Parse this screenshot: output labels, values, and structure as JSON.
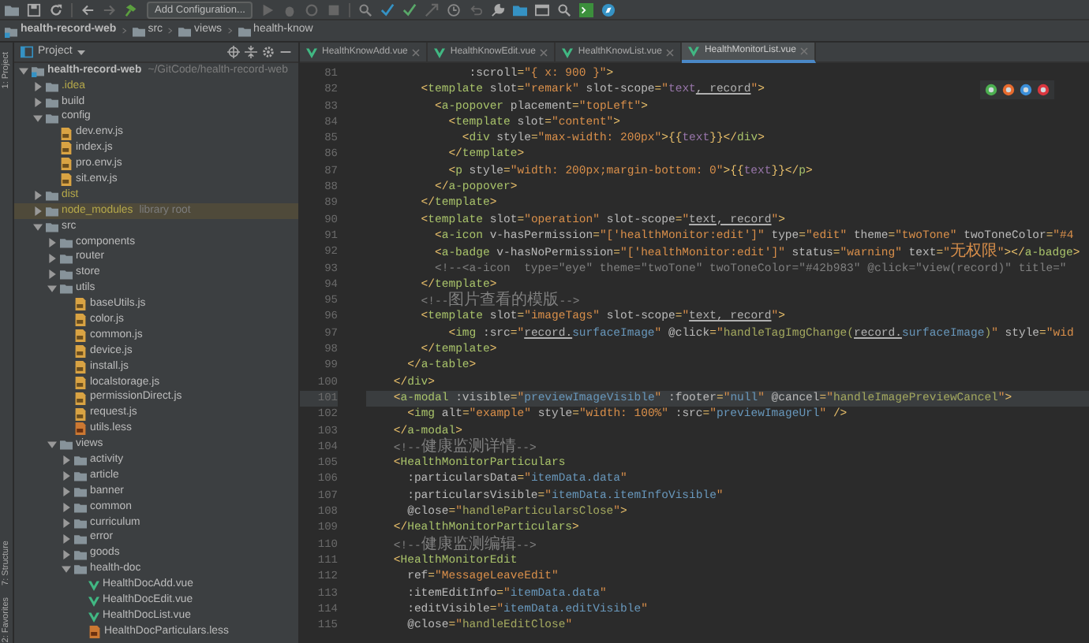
{
  "toolbar": {
    "run_config": "Add Configuration..."
  },
  "breadcrumb": [
    "health-record-web",
    "src",
    "views",
    "health-know"
  ],
  "side_stripe": [
    "1: Project",
    "7: Structure",
    "2: Favorites"
  ],
  "project_panel": {
    "title": "Project",
    "tree": [
      {
        "label": "health-record-web",
        "kind": "project",
        "note": "~/GitCode/health-record-web",
        "expanded": true,
        "ignored": false,
        "selected": false,
        "children": [
          {
            "label": ".idea",
            "kind": "folder",
            "expanded": false,
            "ignored": true,
            "selected": false
          },
          {
            "label": "build",
            "kind": "folder",
            "expanded": false,
            "ignored": false,
            "selected": false
          },
          {
            "label": "config",
            "kind": "folder",
            "expanded": true,
            "ignored": false,
            "selected": false,
            "children": [
              {
                "label": "dev.env.js",
                "kind": "js",
                "ignored": false,
                "selected": false
              },
              {
                "label": "index.js",
                "kind": "js",
                "ignored": false,
                "selected": false
              },
              {
                "label": "pro.env.js",
                "kind": "js",
                "ignored": false,
                "selected": false
              },
              {
                "label": "sit.env.js",
                "kind": "js",
                "ignored": false,
                "selected": false
              }
            ]
          },
          {
            "label": "dist",
            "kind": "folder",
            "expanded": false,
            "ignored": true,
            "selected": false
          },
          {
            "label": "node_modules",
            "kind": "folder",
            "note": "library root",
            "expanded": false,
            "ignored": true,
            "selected": true
          },
          {
            "label": "src",
            "kind": "folder",
            "expanded": true,
            "ignored": false,
            "selected": false,
            "children": [
              {
                "label": "components",
                "kind": "folder",
                "expanded": false,
                "ignored": false,
                "selected": false
              },
              {
                "label": "router",
                "kind": "folder",
                "expanded": false,
                "ignored": false,
                "selected": false
              },
              {
                "label": "store",
                "kind": "folder",
                "expanded": false,
                "ignored": false,
                "selected": false
              },
              {
                "label": "utils",
                "kind": "folder",
                "expanded": true,
                "ignored": false,
                "selected": false,
                "children": [
                  {
                    "label": "baseUtils.js",
                    "kind": "js",
                    "ignored": false,
                    "selected": false
                  },
                  {
                    "label": "color.js",
                    "kind": "js",
                    "ignored": false,
                    "selected": false
                  },
                  {
                    "label": "common.js",
                    "kind": "js",
                    "ignored": false,
                    "selected": false
                  },
                  {
                    "label": "device.js",
                    "kind": "js",
                    "ignored": false,
                    "selected": false
                  },
                  {
                    "label": "install.js",
                    "kind": "js",
                    "ignored": false,
                    "selected": false
                  },
                  {
                    "label": "localstorage.js",
                    "kind": "js",
                    "ignored": false,
                    "selected": false
                  },
                  {
                    "label": "permissionDirect.js",
                    "kind": "js",
                    "ignored": false,
                    "selected": false
                  },
                  {
                    "label": "request.js",
                    "kind": "js",
                    "ignored": false,
                    "selected": false
                  },
                  {
                    "label": "utils.less",
                    "kind": "less",
                    "ignored": false,
                    "selected": false
                  }
                ]
              },
              {
                "label": "views",
                "kind": "folder",
                "expanded": true,
                "ignored": false,
                "selected": false,
                "children": [
                  {
                    "label": "activity",
                    "kind": "folder",
                    "expanded": false,
                    "ignored": false,
                    "selected": false
                  },
                  {
                    "label": "article",
                    "kind": "folder",
                    "expanded": false,
                    "ignored": false,
                    "selected": false
                  },
                  {
                    "label": "banner",
                    "kind": "folder",
                    "expanded": false,
                    "ignored": false,
                    "selected": false
                  },
                  {
                    "label": "common",
                    "kind": "folder",
                    "expanded": false,
                    "ignored": false,
                    "selected": false
                  },
                  {
                    "label": "curriculum",
                    "kind": "folder",
                    "expanded": false,
                    "ignored": false,
                    "selected": false
                  },
                  {
                    "label": "error",
                    "kind": "folder",
                    "expanded": false,
                    "ignored": false,
                    "selected": false
                  },
                  {
                    "label": "goods",
                    "kind": "folder",
                    "expanded": false,
                    "ignored": false,
                    "selected": false
                  },
                  {
                    "label": "health-doc",
                    "kind": "folder",
                    "expanded": true,
                    "ignored": false,
                    "selected": false,
                    "children": [
                      {
                        "label": "HealthDocAdd.vue",
                        "kind": "vue",
                        "ignored": false,
                        "selected": false
                      },
                      {
                        "label": "HealthDocEdit.vue",
                        "kind": "vue",
                        "ignored": false,
                        "selected": false
                      },
                      {
                        "label": "HealthDocList.vue",
                        "kind": "vue",
                        "ignored": false,
                        "selected": false
                      },
                      {
                        "label": "HealthDocParticulars.less",
                        "kind": "less",
                        "ignored": false,
                        "selected": false
                      }
                    ]
                  }
                ]
              }
            ]
          }
        ]
      }
    ]
  },
  "editor": {
    "tabs": [
      {
        "label": "HealthKnowAdd.vue",
        "selected": false
      },
      {
        "label": "HealthKnowEdit.vue",
        "selected": false
      },
      {
        "label": "HealthKnowList.vue",
        "selected": false
      },
      {
        "label": "HealthMonitorList.vue",
        "selected": true
      }
    ],
    "lines": [
      {
        "number": "81",
        "current": false,
        "tokens": [
          {
            "kind": "at",
            "text": "               :scroll"
          },
          {
            "kind": "p",
            "text": "="
          },
          {
            "kind": "str",
            "text": "\"{ x: 900 }\""
          },
          {
            "kind": "p",
            "text": ">"
          }
        ]
      },
      {
        "number": "82",
        "current": false,
        "tokens": [
          {
            "kind": "p",
            "text": "        <"
          },
          {
            "kind": "tag",
            "text": "template"
          },
          {
            "kind": "at",
            "text": " slot"
          },
          {
            "kind": "p",
            "text": "="
          },
          {
            "kind": "str",
            "text": "\"remark\""
          },
          {
            "kind": "at",
            "text": " slot-scope"
          },
          {
            "kind": "p",
            "text": "="
          },
          {
            "kind": "str",
            "text": "\""
          },
          {
            "kind": "var",
            "text": "text"
          },
          {
            "kind": "id",
            "text": ", record"
          },
          {
            "kind": "str",
            "text": "\""
          },
          {
            "kind": "p",
            "text": ">"
          }
        ]
      },
      {
        "number": "83",
        "current": false,
        "tokens": [
          {
            "kind": "p",
            "text": "          <"
          },
          {
            "kind": "tag",
            "text": "a-popover"
          },
          {
            "kind": "at",
            "text": " placement"
          },
          {
            "kind": "p",
            "text": "="
          },
          {
            "kind": "str",
            "text": "\"topLeft\""
          },
          {
            "kind": "p",
            "text": ">"
          }
        ]
      },
      {
        "number": "84",
        "current": false,
        "tokens": [
          {
            "kind": "p",
            "text": "            <"
          },
          {
            "kind": "tag",
            "text": "template"
          },
          {
            "kind": "at",
            "text": " slot"
          },
          {
            "kind": "p",
            "text": "="
          },
          {
            "kind": "str",
            "text": "\"content\""
          },
          {
            "kind": "p",
            "text": ">"
          }
        ]
      },
      {
        "number": "85",
        "current": false,
        "tokens": [
          {
            "kind": "p",
            "text": "              <"
          },
          {
            "kind": "tag",
            "text": "div"
          },
          {
            "kind": "at",
            "text": " style"
          },
          {
            "kind": "p",
            "text": "="
          },
          {
            "kind": "str",
            "text": "\"max-width: 200px\""
          },
          {
            "kind": "p",
            "text": ">{{"
          },
          {
            "kind": "var",
            "text": "text"
          },
          {
            "kind": "p",
            "text": "}}</"
          },
          {
            "kind": "tag",
            "text": "div"
          },
          {
            "kind": "p",
            "text": ">"
          }
        ]
      },
      {
        "number": "86",
        "current": false,
        "tokens": [
          {
            "kind": "p",
            "text": "            </"
          },
          {
            "kind": "tag",
            "text": "template"
          },
          {
            "kind": "p",
            "text": ">"
          }
        ]
      },
      {
        "number": "87",
        "current": false,
        "tokens": [
          {
            "kind": "p",
            "text": "            <"
          },
          {
            "kind": "tag",
            "text": "p"
          },
          {
            "kind": "at",
            "text": " style"
          },
          {
            "kind": "p",
            "text": "="
          },
          {
            "kind": "str",
            "text": "\"width: 200px;margin-bottom: 0\""
          },
          {
            "kind": "p",
            "text": ">{{"
          },
          {
            "kind": "var",
            "text": "text"
          },
          {
            "kind": "p",
            "text": "}}</"
          },
          {
            "kind": "tag",
            "text": "p"
          },
          {
            "kind": "p",
            "text": ">"
          }
        ]
      },
      {
        "number": "88",
        "current": false,
        "tokens": [
          {
            "kind": "p",
            "text": "          </"
          },
          {
            "kind": "tag",
            "text": "a-popover"
          },
          {
            "kind": "p",
            "text": ">"
          }
        ]
      },
      {
        "number": "89",
        "current": false,
        "tokens": [
          {
            "kind": "p",
            "text": "        </"
          },
          {
            "kind": "tag",
            "text": "template"
          },
          {
            "kind": "p",
            "text": ">"
          }
        ]
      },
      {
        "number": "90",
        "current": false,
        "tokens": [
          {
            "kind": "p",
            "text": "        <"
          },
          {
            "kind": "tag",
            "text": "template"
          },
          {
            "kind": "at",
            "text": " slot"
          },
          {
            "kind": "p",
            "text": "="
          },
          {
            "kind": "str",
            "text": "\"operation\""
          },
          {
            "kind": "at",
            "text": " slot-scope"
          },
          {
            "kind": "p",
            "text": "="
          },
          {
            "kind": "str",
            "text": "\""
          },
          {
            "kind": "id",
            "text": "text, record"
          },
          {
            "kind": "str",
            "text": "\""
          },
          {
            "kind": "p",
            "text": ">"
          }
        ]
      },
      {
        "number": "91",
        "current": false,
        "tokens": [
          {
            "kind": "p",
            "text": "          <"
          },
          {
            "kind": "tag",
            "text": "a-icon"
          },
          {
            "kind": "at",
            "text": " v-hasPermission"
          },
          {
            "kind": "p",
            "text": "="
          },
          {
            "kind": "str",
            "text": "\"['healthMonitor:edit']\""
          },
          {
            "kind": "at",
            "text": " type"
          },
          {
            "kind": "p",
            "text": "="
          },
          {
            "kind": "str",
            "text": "\"edit\""
          },
          {
            "kind": "at",
            "text": " theme"
          },
          {
            "kind": "p",
            "text": "="
          },
          {
            "kind": "str",
            "text": "\"twoTone\""
          },
          {
            "kind": "at",
            "text": " twoToneColor"
          },
          {
            "kind": "p",
            "text": "="
          },
          {
            "kind": "str",
            "text": "\"#4"
          }
        ]
      },
      {
        "number": "92",
        "current": false,
        "tokens": [
          {
            "kind": "p",
            "text": "          <"
          },
          {
            "kind": "tag",
            "text": "a-badge"
          },
          {
            "kind": "at",
            "text": " v-hasNoPermission"
          },
          {
            "kind": "p",
            "text": "="
          },
          {
            "kind": "str",
            "text": "\"['healthMonitor:edit']\""
          },
          {
            "kind": "at",
            "text": " status"
          },
          {
            "kind": "p",
            "text": "="
          },
          {
            "kind": "str",
            "text": "\"warning\""
          },
          {
            "kind": "at",
            "text": " text"
          },
          {
            "kind": "p",
            "text": "="
          },
          {
            "kind": "str",
            "text": "\""
          },
          {
            "kind": "strzh",
            "text": "无权限"
          },
          {
            "kind": "str",
            "text": "\""
          },
          {
            "kind": "p",
            "text": "></"
          },
          {
            "kind": "tag",
            "text": "a-badge"
          },
          {
            "kind": "p",
            "text": ">"
          }
        ]
      },
      {
        "number": "93",
        "current": false,
        "tokens": [
          {
            "kind": "cm",
            "text": "          <!--<a-icon  type=\"eye\" theme=\"twoTone\" twoToneColor=\"#42b983\" @click=\"view(record)\" title=\""
          }
        ]
      },
      {
        "number": "94",
        "current": false,
        "tokens": [
          {
            "kind": "p",
            "text": "        </"
          },
          {
            "kind": "tag",
            "text": "template"
          },
          {
            "kind": "p",
            "text": ">"
          }
        ]
      },
      {
        "number": "95",
        "current": false,
        "tokens": [
          {
            "kind": "cm",
            "text": "        <!--"
          },
          {
            "kind": "cmzh",
            "text": "图片查看的模版"
          },
          {
            "kind": "cm",
            "text": "-->"
          }
        ]
      },
      {
        "number": "96",
        "current": false,
        "tokens": [
          {
            "kind": "p",
            "text": "        <"
          },
          {
            "kind": "tag",
            "text": "template"
          },
          {
            "kind": "at",
            "text": " slot"
          },
          {
            "kind": "p",
            "text": "="
          },
          {
            "kind": "str",
            "text": "\"imageTags\""
          },
          {
            "kind": "at",
            "text": " slot-scope"
          },
          {
            "kind": "p",
            "text": "="
          },
          {
            "kind": "str",
            "text": "\""
          },
          {
            "kind": "id",
            "text": "text, record"
          },
          {
            "kind": "str",
            "text": "\""
          },
          {
            "kind": "p",
            "text": ">"
          }
        ]
      },
      {
        "number": "97",
        "current": false,
        "tokens": [
          {
            "kind": "p",
            "text": "            <"
          },
          {
            "kind": "tag",
            "text": "img"
          },
          {
            "kind": "at",
            "text": " :src"
          },
          {
            "kind": "p",
            "text": "="
          },
          {
            "kind": "str",
            "text": "\""
          },
          {
            "kind": "id",
            "text": "record."
          },
          {
            "kind": "js",
            "text": "surfaceImage"
          },
          {
            "kind": "str",
            "text": "\""
          },
          {
            "kind": "at",
            "text": " @click"
          },
          {
            "kind": "p",
            "text": "="
          },
          {
            "kind": "str",
            "text": "\""
          },
          {
            "kind": "fn",
            "text": "handleTagImgChange("
          },
          {
            "kind": "id",
            "text": "record."
          },
          {
            "kind": "js",
            "text": "surfaceImage"
          },
          {
            "kind": "fn",
            "text": ")"
          },
          {
            "kind": "str",
            "text": "\""
          },
          {
            "kind": "at",
            "text": " style"
          },
          {
            "kind": "p",
            "text": "="
          },
          {
            "kind": "str",
            "text": "\"wid"
          }
        ]
      },
      {
        "number": "98",
        "current": false,
        "tokens": [
          {
            "kind": "p",
            "text": "        </"
          },
          {
            "kind": "tag",
            "text": "template"
          },
          {
            "kind": "p",
            "text": ">"
          }
        ]
      },
      {
        "number": "99",
        "current": false,
        "tokens": [
          {
            "kind": "p",
            "text": "      </"
          },
          {
            "kind": "tag",
            "text": "a-table"
          },
          {
            "kind": "p",
            "text": ">"
          }
        ]
      },
      {
        "number": "100",
        "current": false,
        "tokens": [
          {
            "kind": "p",
            "text": "    </"
          },
          {
            "kind": "tag",
            "text": "div"
          },
          {
            "kind": "p",
            "text": ">"
          }
        ]
      },
      {
        "number": "101",
        "current": true,
        "tokens": [
          {
            "kind": "p",
            "text": "    <"
          },
          {
            "kind": "tag",
            "text": "a-modal"
          },
          {
            "kind": "at",
            "text": " :visible"
          },
          {
            "kind": "p",
            "text": "="
          },
          {
            "kind": "str",
            "text": "\""
          },
          {
            "kind": "js",
            "text": "previewImageVisible"
          },
          {
            "kind": "str",
            "text": "\""
          },
          {
            "kind": "at",
            "text": " :footer"
          },
          {
            "kind": "p",
            "text": "="
          },
          {
            "kind": "str",
            "text": "\""
          },
          {
            "kind": "js",
            "text": "null"
          },
          {
            "kind": "str",
            "text": "\""
          },
          {
            "kind": "at",
            "text": " @cancel"
          },
          {
            "kind": "p",
            "text": "="
          },
          {
            "kind": "str",
            "text": "\""
          },
          {
            "kind": "fn",
            "text": "handleImagePreviewCancel"
          },
          {
            "kind": "str",
            "text": "\""
          },
          {
            "kind": "p",
            "text": ">"
          }
        ]
      },
      {
        "number": "102",
        "current": false,
        "tokens": [
          {
            "kind": "p",
            "text": "      <"
          },
          {
            "kind": "tag",
            "text": "img"
          },
          {
            "kind": "at",
            "text": " alt"
          },
          {
            "kind": "p",
            "text": "="
          },
          {
            "kind": "str",
            "text": "\"example\""
          },
          {
            "kind": "at",
            "text": " style"
          },
          {
            "kind": "p",
            "text": "="
          },
          {
            "kind": "str",
            "text": "\"width: 100%\""
          },
          {
            "kind": "at",
            "text": " :src"
          },
          {
            "kind": "p",
            "text": "="
          },
          {
            "kind": "str",
            "text": "\""
          },
          {
            "kind": "js",
            "text": "previewImageUrl"
          },
          {
            "kind": "str",
            "text": "\""
          },
          {
            "kind": "p",
            "text": " />"
          }
        ]
      },
      {
        "number": "103",
        "current": false,
        "tokens": [
          {
            "kind": "p",
            "text": "    </"
          },
          {
            "kind": "tag",
            "text": "a-modal"
          },
          {
            "kind": "p",
            "text": ">"
          }
        ]
      },
      {
        "number": "104",
        "current": false,
        "tokens": [
          {
            "kind": "cm",
            "text": "    <!--"
          },
          {
            "kind": "cmzh",
            "text": "健康监测详情"
          },
          {
            "kind": "cm",
            "text": "-->"
          }
        ]
      },
      {
        "number": "105",
        "current": false,
        "tokens": [
          {
            "kind": "p",
            "text": "    <"
          },
          {
            "kind": "tag",
            "text": "HealthMonitorParticulars"
          }
        ]
      },
      {
        "number": "106",
        "current": false,
        "tokens": [
          {
            "kind": "at",
            "text": "      :particularsData"
          },
          {
            "kind": "p",
            "text": "="
          },
          {
            "kind": "str",
            "text": "\""
          },
          {
            "kind": "js",
            "text": "itemData.data"
          },
          {
            "kind": "str",
            "text": "\""
          }
        ]
      },
      {
        "number": "107",
        "current": false,
        "tokens": [
          {
            "kind": "at",
            "text": "      :particularsVisible"
          },
          {
            "kind": "p",
            "text": "="
          },
          {
            "kind": "str",
            "text": "\""
          },
          {
            "kind": "js",
            "text": "itemData.itemInfoVisible"
          },
          {
            "kind": "str",
            "text": "\""
          }
        ]
      },
      {
        "number": "108",
        "current": false,
        "tokens": [
          {
            "kind": "at",
            "text": "      @close"
          },
          {
            "kind": "p",
            "text": "="
          },
          {
            "kind": "str",
            "text": "\""
          },
          {
            "kind": "fn",
            "text": "handleParticularsClose"
          },
          {
            "kind": "str",
            "text": "\""
          },
          {
            "kind": "p",
            "text": ">"
          }
        ]
      },
      {
        "number": "109",
        "current": false,
        "tokens": [
          {
            "kind": "p",
            "text": "    </"
          },
          {
            "kind": "tag",
            "text": "HealthMonitorParticulars"
          },
          {
            "kind": "p",
            "text": ">"
          }
        ]
      },
      {
        "number": "110",
        "current": false,
        "tokens": [
          {
            "kind": "cm",
            "text": "    <!--"
          },
          {
            "kind": "cmzh",
            "text": "健康监测编辑"
          },
          {
            "kind": "cm",
            "text": "-->"
          }
        ]
      },
      {
        "number": "111",
        "current": false,
        "tokens": [
          {
            "kind": "p",
            "text": "    <"
          },
          {
            "kind": "tag",
            "text": "HealthMonitorEdit"
          }
        ]
      },
      {
        "number": "112",
        "current": false,
        "tokens": [
          {
            "kind": "at",
            "text": "      ref"
          },
          {
            "kind": "p",
            "text": "="
          },
          {
            "kind": "str",
            "text": "\"MessageLeaveEdit\""
          }
        ]
      },
      {
        "number": "113",
        "current": false,
        "tokens": [
          {
            "kind": "at",
            "text": "      :itemEditInfo"
          },
          {
            "kind": "p",
            "text": "="
          },
          {
            "kind": "str",
            "text": "\""
          },
          {
            "kind": "js",
            "text": "itemData.data"
          },
          {
            "kind": "str",
            "text": "\""
          }
        ]
      },
      {
        "number": "114",
        "current": false,
        "tokens": [
          {
            "kind": "at",
            "text": "      :editVisible"
          },
          {
            "kind": "p",
            "text": "="
          },
          {
            "kind": "str",
            "text": "\""
          },
          {
            "kind": "js",
            "text": "itemData.editVisible"
          },
          {
            "kind": "str",
            "text": "\""
          }
        ]
      },
      {
        "number": "115",
        "current": false,
        "tokens": [
          {
            "kind": "at",
            "text": "      @close"
          },
          {
            "kind": "p",
            "text": "="
          },
          {
            "kind": "str",
            "text": "\""
          },
          {
            "kind": "fn",
            "text": "handleEditClose"
          },
          {
            "kind": "str",
            "text": "\""
          }
        ]
      }
    ]
  }
}
